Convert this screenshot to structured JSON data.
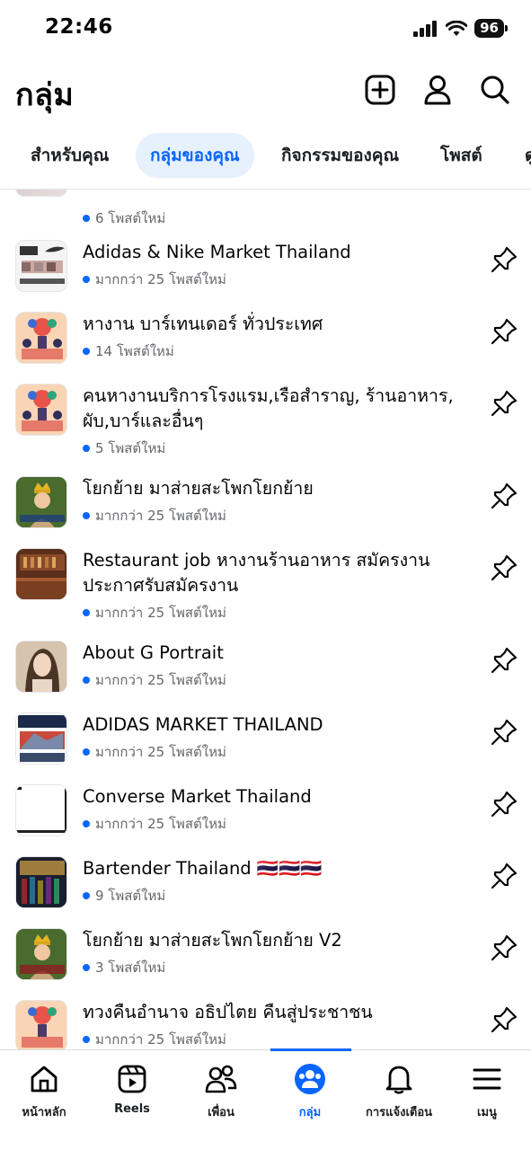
{
  "status_bar": {
    "time": "22:46",
    "battery": "96"
  },
  "header": {
    "title": "กลุ่ม",
    "icons": [
      "plus-square-icon",
      "person-icon",
      "search-icon"
    ]
  },
  "tabs": [
    {
      "label": "สำหรับคุณ",
      "active": false
    },
    {
      "label": "กลุ่มของคุณ",
      "active": true
    },
    {
      "label": "กิจกรรมของคุณ",
      "active": false
    },
    {
      "label": "โพสต์",
      "active": false
    },
    {
      "label": "ดู",
      "active": false
    }
  ],
  "groups": [
    {
      "name": "",
      "meta": "6 โพสต์ใหม่"
    },
    {
      "name": "Adidas & Nike Market Thailand",
      "meta": "มากกว่า 25 โพสต์ใหม่"
    },
    {
      "name": "หางาน บาร์เทนเดอร์ ทั่วประเทศ",
      "meta": "14 โพสต์ใหม่"
    },
    {
      "name": "คนหางานบริการโรงแรม,เรือสำราญ, ร้านอาหาร, ผับ,บาร์และอื่นๆ",
      "meta": "5 โพสต์ใหม่"
    },
    {
      "name": "โยกย้าย มาส่ายสะโพกโยกย้าย",
      "meta": "มากกว่า 25 โพสต์ใหม่"
    },
    {
      "name": "Restaurant job หางานร้านอาหาร สมัครงาน ประกาศรับสมัครงาน",
      "meta": "มากกว่า 25 โพสต์ใหม่"
    },
    {
      "name": "About G Portrait",
      "meta": "มากกว่า 25 โพสต์ใหม่"
    },
    {
      "name": "ADIDAS MARKET THAILAND",
      "meta": "มากกว่า 25 โพสต์ใหม่"
    },
    {
      "name": "Converse Market Thailand",
      "meta": "มากกว่า 25 โพสต์ใหม่"
    },
    {
      "name": "Bartender Thailand 🇹🇭🇹🇭🇹🇭",
      "meta": "9 โพสต์ใหม่"
    },
    {
      "name": "โยกย้าย มาส่ายสะโพกโยกย้าย V2",
      "meta": "3 โพสต์ใหม่"
    },
    {
      "name": "ทวงคืนอำนาจ อธิปไตย คืนสู่ประชาชน",
      "meta": "มากกว่า 25 โพสต์ใหม่"
    }
  ],
  "bottom_nav": [
    {
      "label": "หน้าหลัก",
      "icon": "home-icon",
      "active": false
    },
    {
      "label": "Reels",
      "icon": "reels-icon",
      "active": false
    },
    {
      "label": "เพื่อน",
      "icon": "friends-icon",
      "active": false
    },
    {
      "label": "กลุ่ม",
      "icon": "groups-icon",
      "active": true
    },
    {
      "label": "การแจ้งเตือน",
      "icon": "bell-icon",
      "active": false
    },
    {
      "label": "เมนู",
      "icon": "menu-icon",
      "active": false
    }
  ],
  "colors": {
    "accent": "#0866ff",
    "muted": "#65676b",
    "active_tab_bg": "#e7f0fd"
  }
}
